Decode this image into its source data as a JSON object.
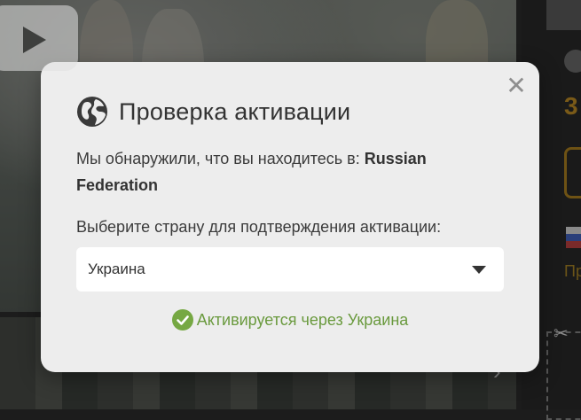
{
  "modal": {
    "title": "Проверка активации",
    "detected_prefix": "Мы обнаружили, что вы находитесь в: ",
    "detected_country": "Russian Federation",
    "choose_label": "Выберите страну для подтверждения активации:",
    "selected_country": "Украина",
    "status_text": "Активируется через Украина",
    "close_symbol": "✕",
    "icons": {
      "globe": "globe-icon",
      "close": "close-icon",
      "check": "check-circle-icon",
      "caret": "chevron-down-icon"
    },
    "colors": {
      "background": "#ededed",
      "status_green": "#6a9a3e",
      "check_green": "#76a843",
      "text": "#333333"
    }
  },
  "background": {
    "side_price_fragment": "3",
    "side_link_fragment": "Пр"
  }
}
